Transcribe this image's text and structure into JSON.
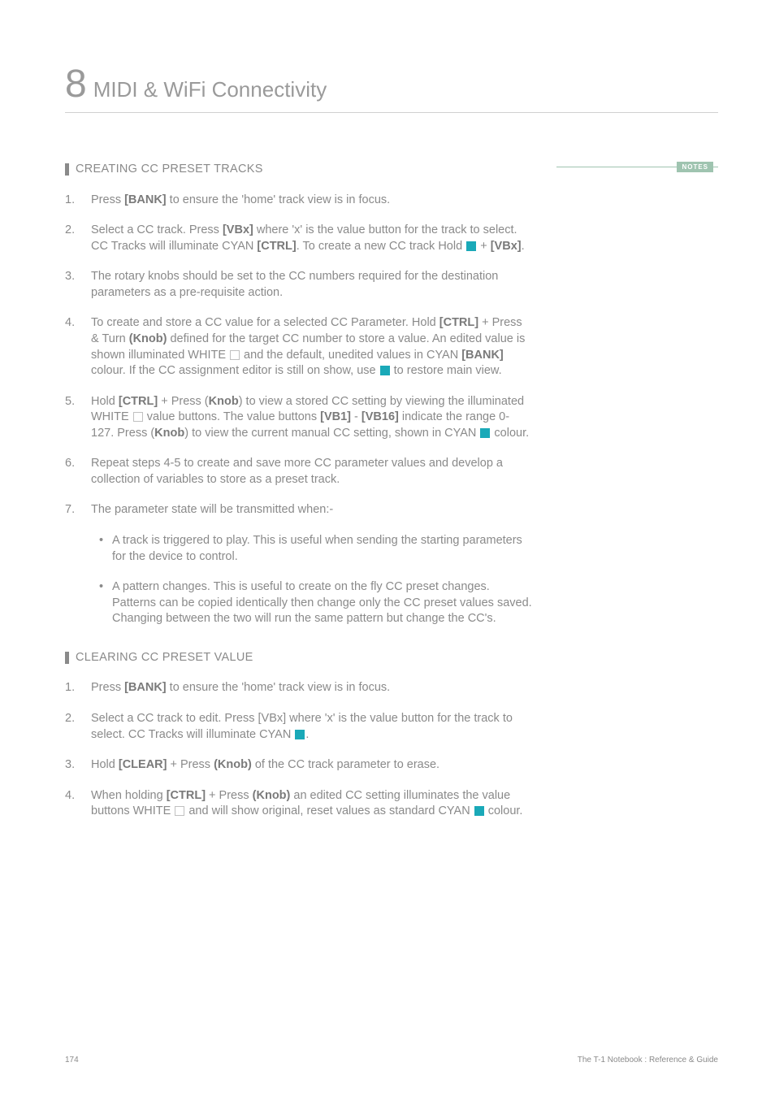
{
  "chapter": {
    "number": "8",
    "title": "MIDI & WiFi Connectivity"
  },
  "notes_label": "NOTES",
  "sections": [
    {
      "title": "CREATING CC PRESET TRACKS",
      "items": [
        {
          "leading": "Press ",
          "b1": "[BANK]",
          "trailing": " to ensure the 'home' track view is in focus."
        },
        {
          "leading": "Select a CC track. Press ",
          "b1": "[VBx]",
          "mid1": " where 'x' is the value button for the track to select. CC Tracks will illuminate CYAN ",
          "swatch1": "cyan",
          "mid2": ". To create a new CC track Hold ",
          "b2": "[CTRL]",
          "mid3": " + ",
          "b3": "[VBx]",
          "trailing": "."
        },
        {
          "leading": "The rotary knobs should be set to the CC numbers required for the destination parameters as a pre-requisite action."
        },
        {
          "leading": "To create and store a CC value for a selected CC Parameter. Hold ",
          "b1": "[CTRL]",
          "mid1": " + Press & Turn ",
          "b2": "(Knob)",
          "mid2": " defined for the target CC number to store a value. An edited value is shown illuminated WHITE ",
          "swatch1": "white",
          "mid3": " and the default, unedited values in CYAN ",
          "swatch2": "cyan",
          "mid4": " colour. If the CC assignment editor is still on show, use ",
          "b3": "[BANK]",
          "trailing": " to restore main view."
        },
        {
          "leading": "Hold ",
          "b1": "[CTRL]",
          "mid1": " + Press (",
          "b2": "Knob",
          "mid2": ") to view a stored CC setting by viewing the illuminated WHITE ",
          "swatch1": "white",
          "mid3": " value buttons. The value buttons ",
          "b3": "[VB1]",
          "mid4": " - ",
          "b4": "[VB16]",
          "mid5": " indicate the range 0-127.  Press (",
          "b5": "Knob",
          "mid6": ") to view the current manual CC setting, shown in CYAN ",
          "swatch2": "cyan",
          "trailing": " colour."
        },
        {
          "leading": "Repeat steps 4-5 to create and save more CC parameter values and develop a collection of variables to store as a preset track."
        },
        {
          "leading": "The parameter state will be transmitted when:-",
          "sub": [
            "A track is triggered to play. This is useful when sending the starting parameters for the device to control.",
            "A pattern changes. This is useful to create on the fly CC preset changes. Patterns can be copied identically then change only the CC preset values saved. Changing between the two will run the same pattern but change the CC's."
          ]
        }
      ]
    },
    {
      "title": "CLEARING CC PRESET VALUE",
      "items": [
        {
          "leading": "Press ",
          "b1": "[BANK]",
          "trailing": " to ensure the 'home' track view is in focus."
        },
        {
          "leading": "Select a CC track to edit. Press [VBx] where 'x' is the value button for the track to select. CC Tracks will illuminate CYAN ",
          "swatch1": "cyan",
          "trailing": "."
        },
        {
          "leading": "Hold ",
          "b1": "[CLEAR]",
          "mid1": " + Press ",
          "b2": "(Knob)",
          "trailing": " of the CC track parameter to erase."
        },
        {
          "leading": "When holding ",
          "b1": "[CTRL]",
          "mid1": " + Press ",
          "b2": "(Knob)",
          "mid2": " an edited CC setting illuminates the value buttons WHITE ",
          "swatch1": "white",
          "mid3": " and will show original, reset values as standard CYAN ",
          "swatch2": "cyan",
          "trailing": " colour."
        }
      ]
    }
  ],
  "footer": {
    "page_number": "174",
    "doc_title": "The T-1 Notebook : Reference & Guide"
  }
}
